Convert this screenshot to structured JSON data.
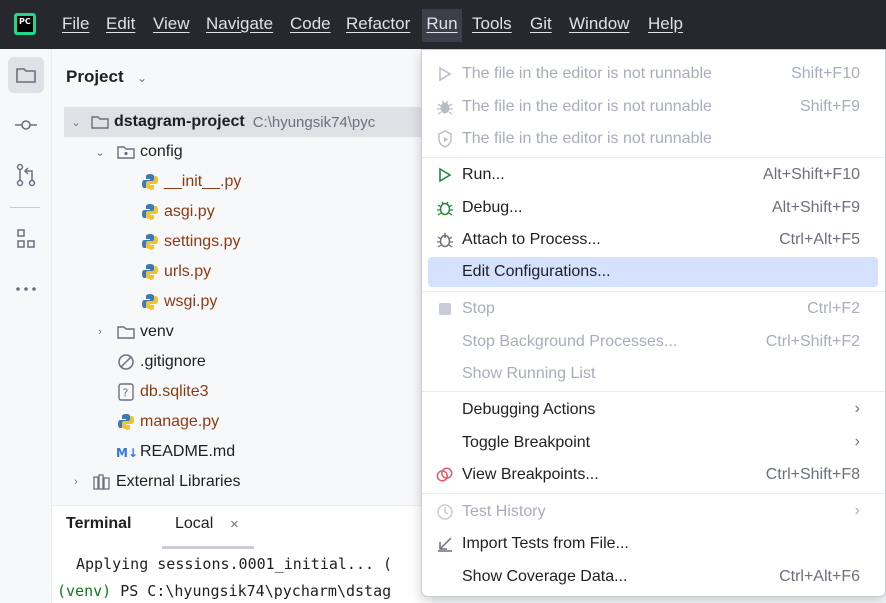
{
  "menubar": {
    "logo_text": "PC",
    "items": [
      "File",
      "Edit",
      "View",
      "Navigate",
      "Code",
      "Refactor",
      "Run",
      "Tools",
      "Git",
      "Window",
      "Help"
    ]
  },
  "project": {
    "title": "Project",
    "tree": [
      {
        "name": "dstagram-project",
        "path": "C:\\hyungsik74\\pyc"
      },
      {
        "name": "config"
      },
      {
        "name": "__init__.py"
      },
      {
        "name": "asgi.py"
      },
      {
        "name": "settings.py"
      },
      {
        "name": "urls.py"
      },
      {
        "name": "wsgi.py"
      },
      {
        "name": "venv"
      },
      {
        "name": ".gitignore"
      },
      {
        "name": "db.sqlite3"
      },
      {
        "name": "manage.py"
      },
      {
        "name": "README.md"
      },
      {
        "name": "External Libraries"
      }
    ]
  },
  "terminal": {
    "title": "Terminal",
    "tab": "Local",
    "close": "×",
    "lines": [
      "Applying sessions.0001_initial... (",
      "PS C:\\hyungsik74\\pycharm\\dstag"
    ],
    "venv_prefix": "(venv)"
  },
  "run_menu": {
    "items": [
      {
        "label": "The file in the editor is not runnable",
        "shortcut": "Shift+F10",
        "icon": "run-icon",
        "disabled": true
      },
      {
        "label": "The file in the editor is not runnable",
        "shortcut": "Shift+F9",
        "icon": "debug-icon",
        "disabled": true
      },
      {
        "label": "The file in the editor is not runnable",
        "shortcut": "",
        "icon": "coverage-icon",
        "disabled": true
      },
      {
        "label": "Run...",
        "shortcut": "Alt+Shift+F10",
        "icon": "run-icon",
        "disabled": false
      },
      {
        "label": "Debug...",
        "shortcut": "Alt+Shift+F9",
        "icon": "debug-icon",
        "disabled": false
      },
      {
        "label": "Attach to Process...",
        "shortcut": "Ctrl+Alt+F5",
        "icon": "attach-icon",
        "disabled": false
      },
      {
        "label": "Edit Configurations...",
        "shortcut": "",
        "icon": "",
        "disabled": false,
        "highlighted": true
      },
      {
        "label": "Stop",
        "shortcut": "Ctrl+F2",
        "icon": "stop-icon",
        "disabled": true
      },
      {
        "label": "Stop Background Processes...",
        "shortcut": "Ctrl+Shift+F2",
        "icon": "",
        "disabled": true
      },
      {
        "label": "Show Running List",
        "shortcut": "",
        "icon": "",
        "disabled": true
      },
      {
        "label": "Debugging Actions",
        "shortcut": "",
        "icon": "",
        "disabled": false,
        "submenu": true
      },
      {
        "label": "Toggle Breakpoint",
        "shortcut": "",
        "icon": "",
        "disabled": false,
        "submenu": true
      },
      {
        "label": "View Breakpoints...",
        "shortcut": "Ctrl+Shift+F8",
        "icon": "breakpoints-icon",
        "disabled": false
      },
      {
        "label": "Test History",
        "shortcut": "",
        "icon": "history-icon",
        "disabled": true,
        "submenu": true
      },
      {
        "label": "Import Tests from File...",
        "shortcut": "",
        "icon": "import-icon",
        "disabled": false
      },
      {
        "label": "Show Coverage Data...",
        "shortcut": "Ctrl+Alt+F6",
        "icon": "",
        "disabled": false
      }
    ]
  },
  "colors": {
    "accent": "#d4e2ff",
    "menubar_bg": "#27282e",
    "python_file": "#8c3a12",
    "venv": "#067d17"
  }
}
